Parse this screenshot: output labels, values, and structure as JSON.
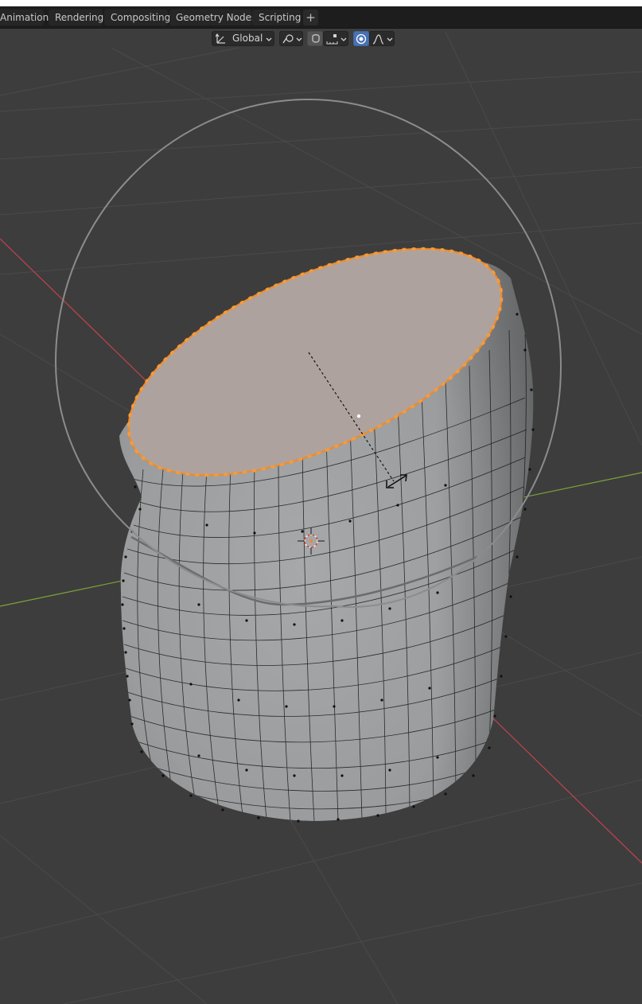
{
  "workspace_tabs": [
    "Animation",
    "Rendering",
    "Compositing",
    "Geometry Nodes",
    "Scripting"
  ],
  "add_tab_label": "+",
  "header": {
    "orientation": "Global"
  },
  "colors": {
    "viewport_bg": "#3d3d3d",
    "x_axis": "#c2434f",
    "y_axis": "#7da33a",
    "selection": "#f08a24",
    "mesh_face": "#9ea0a2",
    "tabbar_bg": "#1d1d1d"
  },
  "icons": [
    "transform-orientation-icon",
    "pivot-point-icon",
    "snap-magnet-icon",
    "snap-increment-icon",
    "proportional-editing-icon",
    "falloff-curve-icon",
    "3d-cursor-icon",
    "transform-arrows-icon"
  ]
}
